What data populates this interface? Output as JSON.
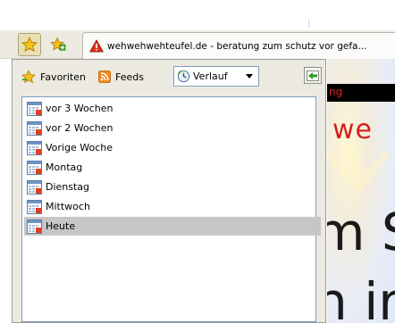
{
  "toolbar": {
    "buttons": [
      {
        "icon": "favorites-star-icon"
      },
      {
        "icon": "add-favorite-icon"
      }
    ]
  },
  "tab": {
    "title": "wehwehwehteufel.de - beratung zum schutz vor gefa...",
    "icon": "warning-icon"
  },
  "sidebar": {
    "favorites_label": "Favoriten",
    "feeds_label": "Feeds",
    "history_select": {
      "value": "Verlauf"
    },
    "history_items": [
      {
        "label": "vor 3 Wochen"
      },
      {
        "label": "vor 2 Wochen"
      },
      {
        "label": "Vorige Woche"
      },
      {
        "label": "Montag"
      },
      {
        "label": "Dienstag"
      },
      {
        "label": "Mittwoch"
      },
      {
        "label": "Heute",
        "selected": true
      }
    ]
  },
  "page": {
    "bar_text": "ng",
    "heading": "we",
    "big_text_1": "m S",
    "big_text_2": "n ir"
  },
  "colors": {
    "accent_red": "#d42020",
    "selection": "#c6c6c6",
    "chrome": "#eceae0"
  }
}
